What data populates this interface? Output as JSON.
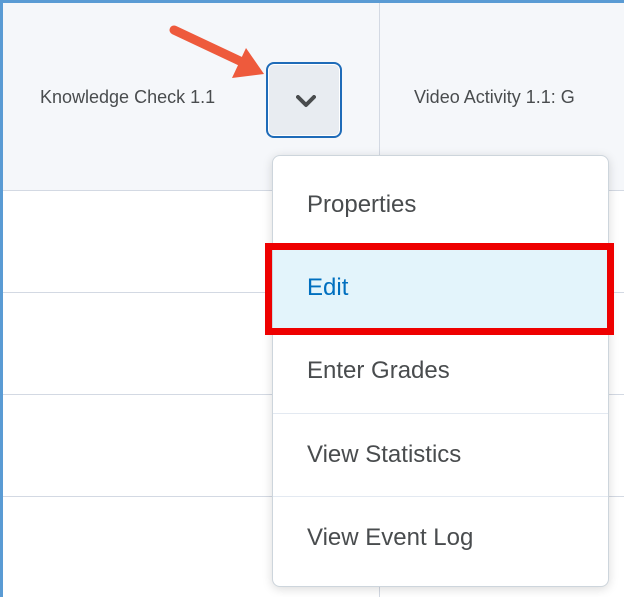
{
  "header": {
    "column1_title": "Knowledge Check 1.1",
    "column2_title": "Video Activity 1.1: G"
  },
  "dropdown": {
    "icon": "chevron-down-icon"
  },
  "menu": {
    "items": [
      {
        "label": "Properties"
      },
      {
        "label": "Edit"
      },
      {
        "label": "Enter Grades"
      },
      {
        "label": "View Statistics"
      },
      {
        "label": "View Event Log"
      }
    ],
    "highlighted_index": 1
  },
  "colors": {
    "header_bg": "#f5f7fa",
    "border": "#d3d9e3",
    "button_border": "#1e6bb8",
    "active_bg": "#e3f4fb",
    "active_text": "#006fbf",
    "highlight": "#ee0000",
    "arrow": "#ee5a3c"
  }
}
